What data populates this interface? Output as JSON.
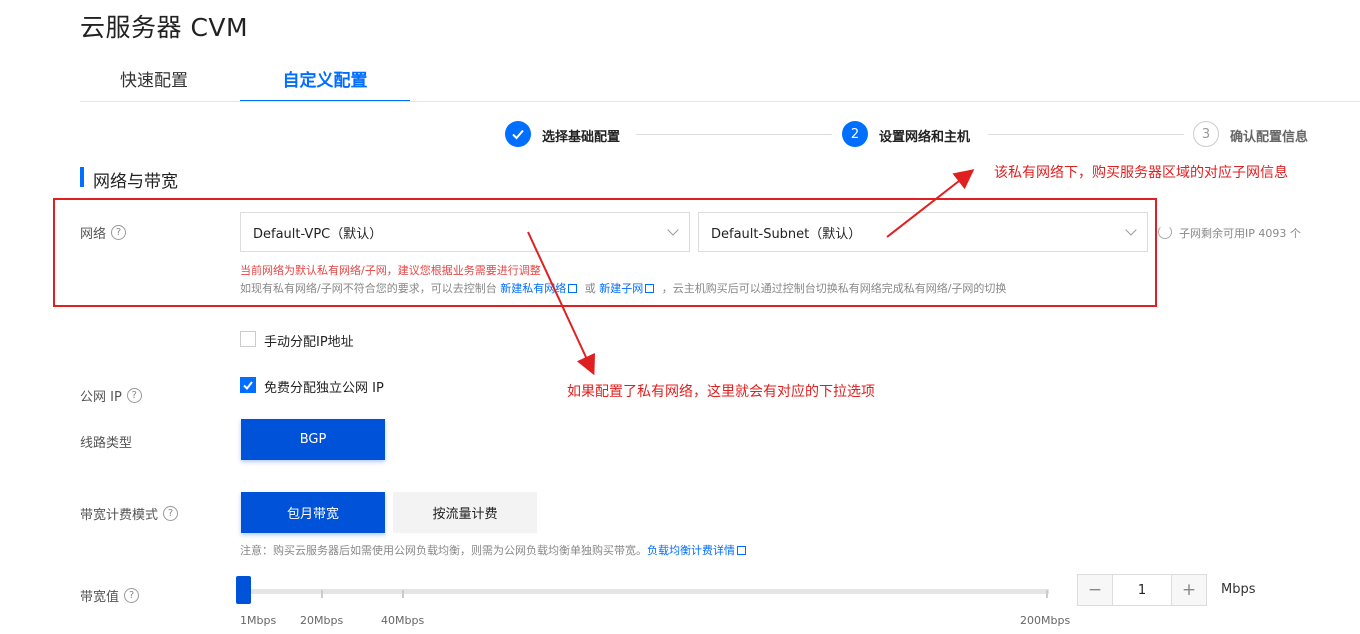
{
  "page": {
    "title": "云服务器 CVM"
  },
  "tabs": [
    {
      "label": "快速配置",
      "active": false
    },
    {
      "label": "自定义配置",
      "active": true
    }
  ],
  "steps": [
    {
      "num": "✓",
      "label": "选择基础配置",
      "state": "done"
    },
    {
      "num": "2",
      "label": "设置网络和主机",
      "state": "current"
    },
    {
      "num": "3",
      "label": "确认配置信息",
      "state": "todo"
    }
  ],
  "section": {
    "title": "网络与带宽"
  },
  "network": {
    "label": "网络",
    "vpc_value": "Default-VPC（默认）",
    "subnet_value": "Default-Subnet（默认）",
    "ip_remaining": "子网剩余可用IP 4093 个",
    "warning": "当前网络为默认私有网络/子网，建议您根据业务需要进行调整",
    "hint_prefix": "如现有私有网络/子网不符合您的要求，可以去控制台",
    "hint_link1": "新建私有网络",
    "hint_or": "或",
    "hint_link2": "新建子网",
    "hint_suffix": "，云主机购买后可以通过控制台切换私有网络完成私有网络/子网的切换"
  },
  "manual_ip": {
    "label": "手动分配IP地址",
    "checked": false
  },
  "public_ip": {
    "label": "公网 IP",
    "checkbox_label": "免费分配独立公网 IP",
    "checked": true
  },
  "line_type": {
    "label": "线路类型",
    "option": "BGP"
  },
  "billing": {
    "label": "带宽计费模式",
    "options": [
      "包月带宽",
      "按流量计费"
    ],
    "note_prefix": "注意：购买云服务器后如需使用公网负载均衡，则需为公网负载均衡单独购买带宽。",
    "note_link": "负载均衡计费详情"
  },
  "bandwidth": {
    "label": "带宽值",
    "value": "1",
    "unit": "Mbps",
    "min": 1,
    "max": 200,
    "ticks": [
      "1Mbps",
      "20Mbps",
      "40Mbps",
      "200Mbps"
    ],
    "minus": "−",
    "plus": "+"
  },
  "annotations": {
    "top": "该私有网络下，购买服务器区域的对应子网信息",
    "bottom": "如果配置了私有网络，这里就会有对应的下拉选项"
  },
  "colors": {
    "accent": "#006eff",
    "primary_button": "#0052d9",
    "annotation": "#e02020"
  }
}
